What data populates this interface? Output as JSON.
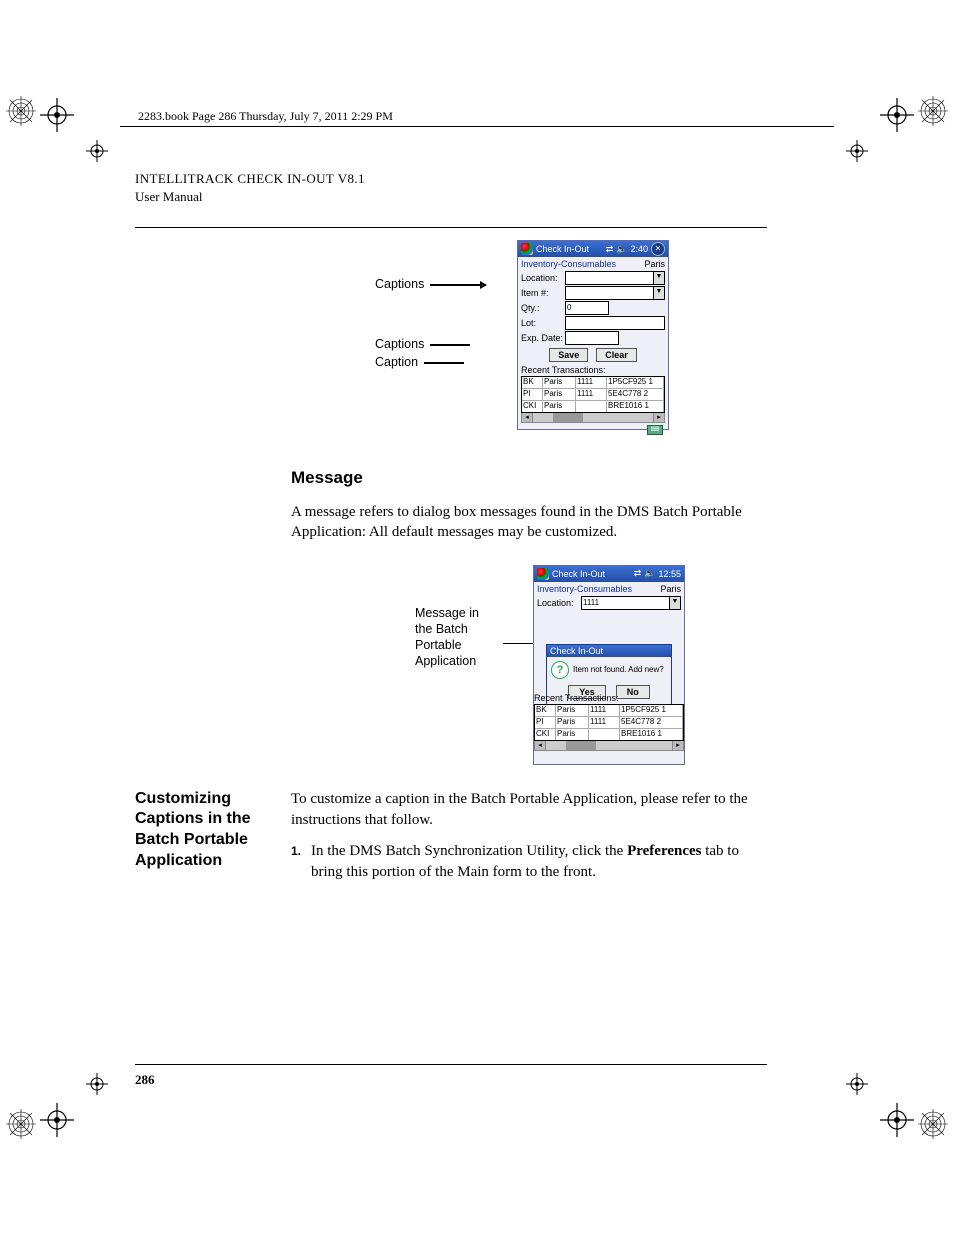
{
  "crop_label": "2283.book  Page 286  Thursday, July 7, 2011  2:29 PM",
  "running_head": {
    "line1_pre": "I",
    "line1_sc1": "NTELLI",
    "line1_mid": "T",
    "line1_sc2": "RACK",
    "line1_rest": " C",
    "line1_sc3": "HECK",
    "line1_rest2": " I",
    "line1_sc4": "N",
    "line1_rest3": "-O",
    "line1_sc5": "UT",
    "line1_tail": " V8.1",
    "line2": "User Manual"
  },
  "fig1": {
    "callout1": "Captions",
    "callout2": "Captions",
    "callout3": "Caption",
    "title": "Check In-Out",
    "time": "2:40",
    "breadcrumb_left": "Inventory-Consumables",
    "breadcrumb_right": "Paris",
    "labels": {
      "location": "Location:",
      "item": "Item #:",
      "qty": "Qty.:",
      "qty_val": "0",
      "lot": "Lot:",
      "exp": "Exp. Date:"
    },
    "buttons": {
      "save": "Save",
      "clear": "Clear"
    },
    "recent_label": "Recent Transactions:",
    "rows": [
      {
        "c1": "BK",
        "c2": "Paris",
        "c3": "1111",
        "c4": "1P5CF925 1"
      },
      {
        "c1": "PI",
        "c2": "Paris",
        "c3": "1111",
        "c4": "5E4C778 2"
      },
      {
        "c1": "CKI",
        "c2": "Paris",
        "c3": "",
        "c4": "BRE1016 1"
      }
    ]
  },
  "section1": {
    "heading": "Message",
    "para": "A message refers to dialog box messages found in the DMS Batch Portable Application: All default messages may be customized."
  },
  "fig2": {
    "callout_l1": "Message in",
    "callout_l2": "the Batch",
    "callout_l3": "Portable",
    "callout_l4": "Application",
    "title": "Check In-Out",
    "time": "12:55",
    "breadcrumb_left": "Inventory-Consumables",
    "breadcrumb_right": "Paris",
    "location_label": "Location:",
    "location_val": "1111",
    "dialog_title": "Check In-Out",
    "dialog_msg": "Item not found. Add new?",
    "yes": "Yes",
    "no": "No",
    "recent_label": "Recent Transactions:",
    "rows": [
      {
        "c1": "BK",
        "c2": "Paris",
        "c3": "1111",
        "c4": "1P5CF925 1"
      },
      {
        "c1": "PI",
        "c2": "Paris",
        "c3": "1111",
        "c4": "5E4C778 2"
      },
      {
        "c1": "CKI",
        "c2": "Paris",
        "c3": "",
        "c4": "BRE1016 1"
      }
    ]
  },
  "section2": {
    "side_heading": "Customizing Captions in the Batch Portable Application",
    "intro": "To customize a caption in the Batch Portable Application, please refer to the instructions that follow.",
    "step_num": "1.",
    "step_pre": "In the DMS Batch Synchronization Utility, click the ",
    "step_bold": "Preferences",
    "step_post": " tab to bring this portion of the Main form to the front."
  },
  "page_number": "286"
}
